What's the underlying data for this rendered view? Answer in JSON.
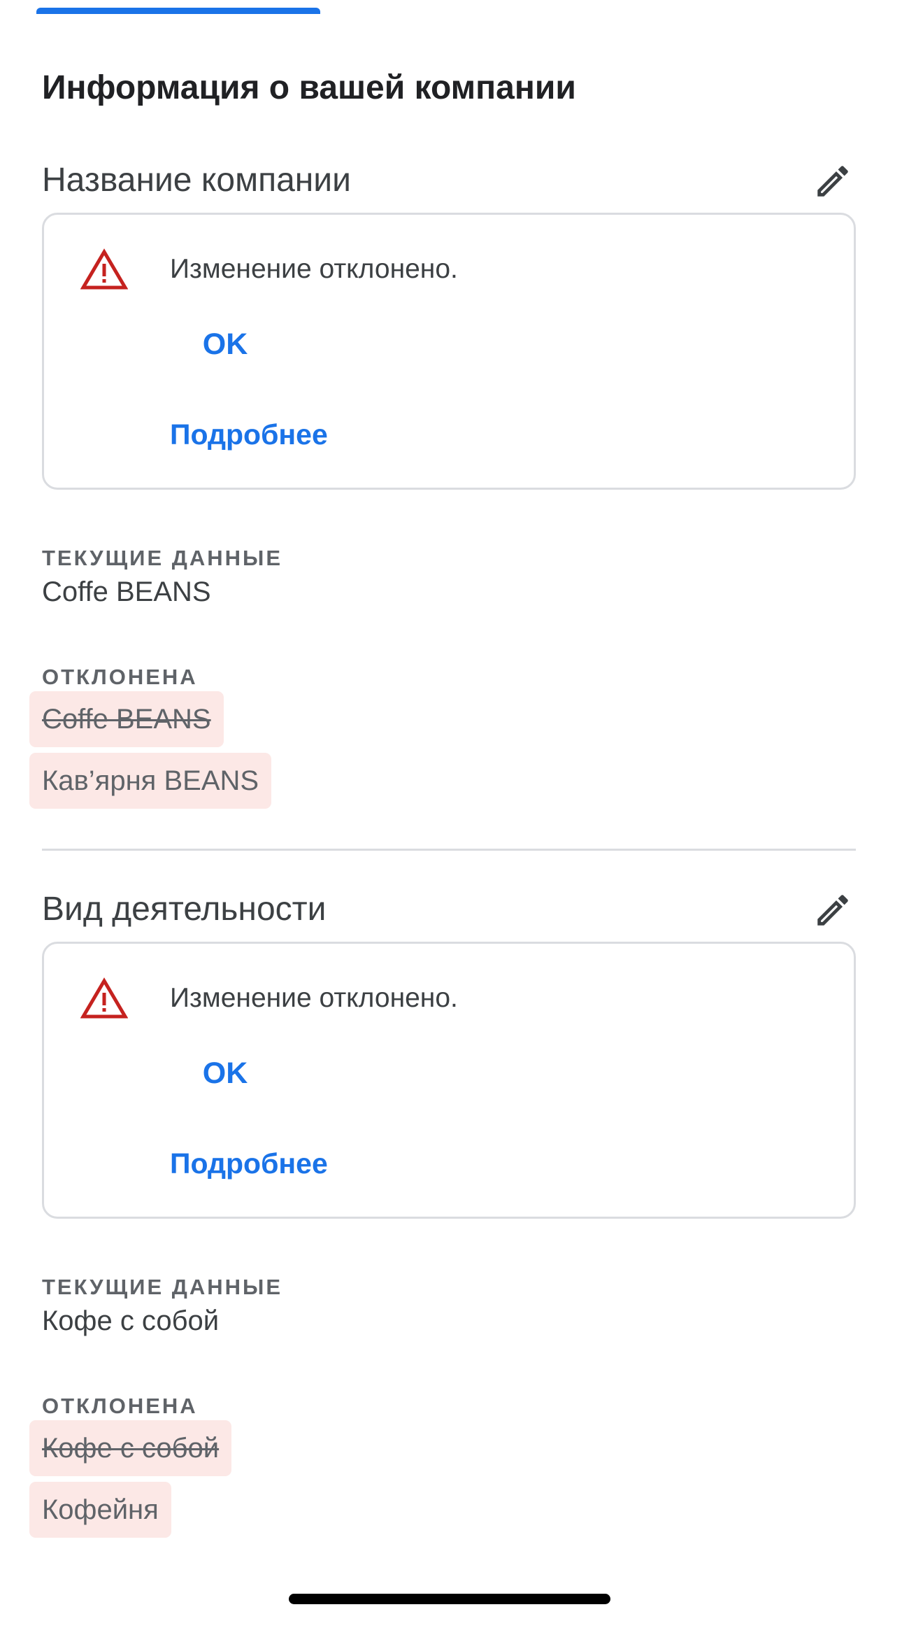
{
  "page": {
    "title": "Информация о вашей компании"
  },
  "colors": {
    "accent": "#1a73e8",
    "warning": "#c5221f",
    "rejected_chip_bg": "#fce8e6",
    "border": "#dadce0"
  },
  "sections": [
    {
      "title": "Название компании",
      "edit_icon": "pencil-icon",
      "alert": {
        "icon": "warning-triangle-icon",
        "message": "Изменение отклонено.",
        "ok_label": "OK",
        "more_label": "Подробнее"
      },
      "current": {
        "label": "ТЕКУЩИЕ ДАННЫЕ",
        "value": "Coffe BEANS"
      },
      "rejected": {
        "label": "ОТКЛОНЕНА",
        "old_value": "Coffe BEANS",
        "new_value": "Кав’ярня BEANS"
      }
    },
    {
      "title": "Вид деятельности",
      "edit_icon": "pencil-icon",
      "alert": {
        "icon": "warning-triangle-icon",
        "message": "Изменение отклонено.",
        "ok_label": "OK",
        "more_label": "Подробнее"
      },
      "current": {
        "label": "ТЕКУЩИЕ ДАННЫЕ",
        "value": "Кофе с собой"
      },
      "rejected": {
        "label": "ОТКЛОНЕНА",
        "old_value": "Кофе с собой",
        "new_value": "Кофейня"
      }
    }
  ]
}
